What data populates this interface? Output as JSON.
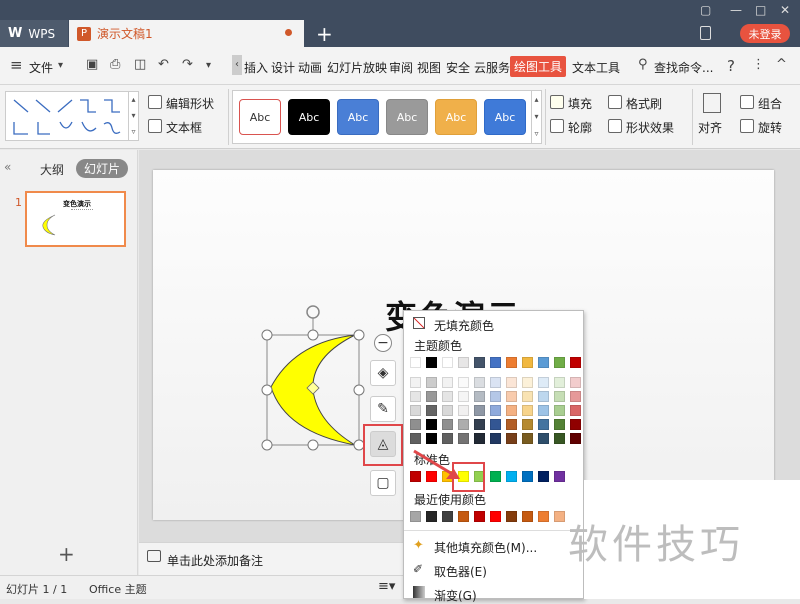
{
  "titlebar": {
    "app_tab": "WPS",
    "doc_tab": "演示文稿1",
    "doc_badge": "P",
    "new_tab": "+",
    "login": "未登录",
    "win_controls": [
      "▢",
      "—",
      "□",
      "✕"
    ]
  },
  "menubar": {
    "file": "文件",
    "items": [
      "插入",
      "设计",
      "动画",
      "幻灯片放映",
      "审阅",
      "视图",
      "安全",
      "云服务"
    ],
    "active": "绘图工具",
    "text_tools": "文本工具",
    "search": "查找命令...",
    "help": "?",
    "more": "⋮",
    "collapse": "^"
  },
  "ribbon": {
    "edit_shape": "编辑形状",
    "text_box": "文本框",
    "style_label": "Abc",
    "styles": [
      {
        "bg": "#ffffff",
        "fg": "#333333",
        "border": "#d9534f"
      },
      {
        "bg": "#000000",
        "fg": "#ffffff",
        "border": "#000000"
      },
      {
        "bg": "#4a7fd6",
        "fg": "#ffffff",
        "border": "#3a6cc0"
      },
      {
        "bg": "#9a9a9a",
        "fg": "#ffffff",
        "border": "#888888"
      },
      {
        "bg": "#f0b04a",
        "fg": "#ffffff",
        "border": "#e0a03a"
      },
      {
        "bg": "#3f7ad8",
        "fg": "#ffffff",
        "border": "#2f6ac8"
      }
    ],
    "fill": "填充",
    "format_painter": "格式刷",
    "outline": "轮廓",
    "shape_effects": "形状效果",
    "align": "对齐",
    "group": "组合",
    "rotate": "旋转"
  },
  "leftpanel": {
    "outline_tab": "大纲",
    "slides_tab": "幻灯片",
    "slide_number": "1",
    "thumb_title": "变色演示",
    "add": "+"
  },
  "slide": {
    "title": "变色演示"
  },
  "notes": {
    "placeholder": "单击此处添加备注"
  },
  "status": {
    "slide_count": "幻灯片 1 / 1",
    "theme": "Office 主题"
  },
  "dropdown": {
    "no_fill": "无填充颜色",
    "theme_colors": "主题颜色",
    "standard_colors": "标准色",
    "recent_colors": "最近使用颜色",
    "more_colors": "其他填充颜色(M)...",
    "eyedropper": "取色器(E)",
    "gradient": "渐变(G)",
    "theme_top": [
      "#ffffff",
      "#000000",
      "#ffffff",
      "#e7e6e6",
      "#44546a",
      "#4472c4",
      "#ed7d31",
      "#f1b840",
      "#5b9bd5",
      "#70ad47",
      "#c00000"
    ],
    "standard": [
      "#c00000",
      "#ff0000",
      "#ffc000",
      "#ffff00",
      "#92d050",
      "#00b050",
      "#00b0f0",
      "#0070c0",
      "#002060",
      "#7030a0"
    ],
    "recent": [
      "#a6a6a6",
      "#262626",
      "#404040",
      "#c55a11",
      "#c00000",
      "#ff0000",
      "#843c0c",
      "#c55a11",
      "#ed7d31",
      "#f4b183"
    ]
  },
  "watermark": "软件技巧",
  "accent": "#e8533f",
  "shape_fill": "#ffff00"
}
